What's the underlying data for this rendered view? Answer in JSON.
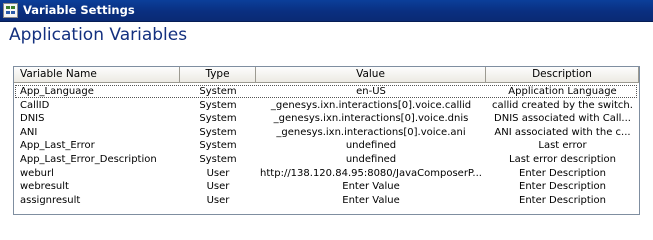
{
  "window": {
    "title": "Variable Settings"
  },
  "page": {
    "title": "Application Variables"
  },
  "columns": [
    "Variable Name",
    "Type",
    "Value",
    "Description"
  ],
  "rows": [
    {
      "name": "App_Language",
      "type": "System",
      "value": "en-US",
      "description": "Application Language"
    },
    {
      "name": "CallID",
      "type": "System",
      "value": "_genesys.ixn.interactions[0].voice.callid",
      "description": "callid created by the switch."
    },
    {
      "name": "DNIS",
      "type": "System",
      "value": "_genesys.ixn.interactions[0].voice.dnis",
      "description": "DNIS associated with Call..."
    },
    {
      "name": "ANI",
      "type": "System",
      "value": "_genesys.ixn.interactions[0].voice.ani",
      "description": "ANI associated with the c..."
    },
    {
      "name": "App_Last_Error",
      "type": "System",
      "value": "undefined",
      "description": "Last error"
    },
    {
      "name": "App_Last_Error_Description",
      "type": "System",
      "value": "undefined",
      "description": "Last error description"
    },
    {
      "name": "weburl",
      "type": "User",
      "value": "http://138.120.84.95:8080/JavaComposerP...",
      "description": "Enter Description"
    },
    {
      "name": "webresult",
      "type": "User",
      "value": "Enter Value",
      "description": "Enter Description"
    },
    {
      "name": "assignresult",
      "type": "User",
      "value": "Enter Value",
      "description": "Enter Description"
    }
  ]
}
